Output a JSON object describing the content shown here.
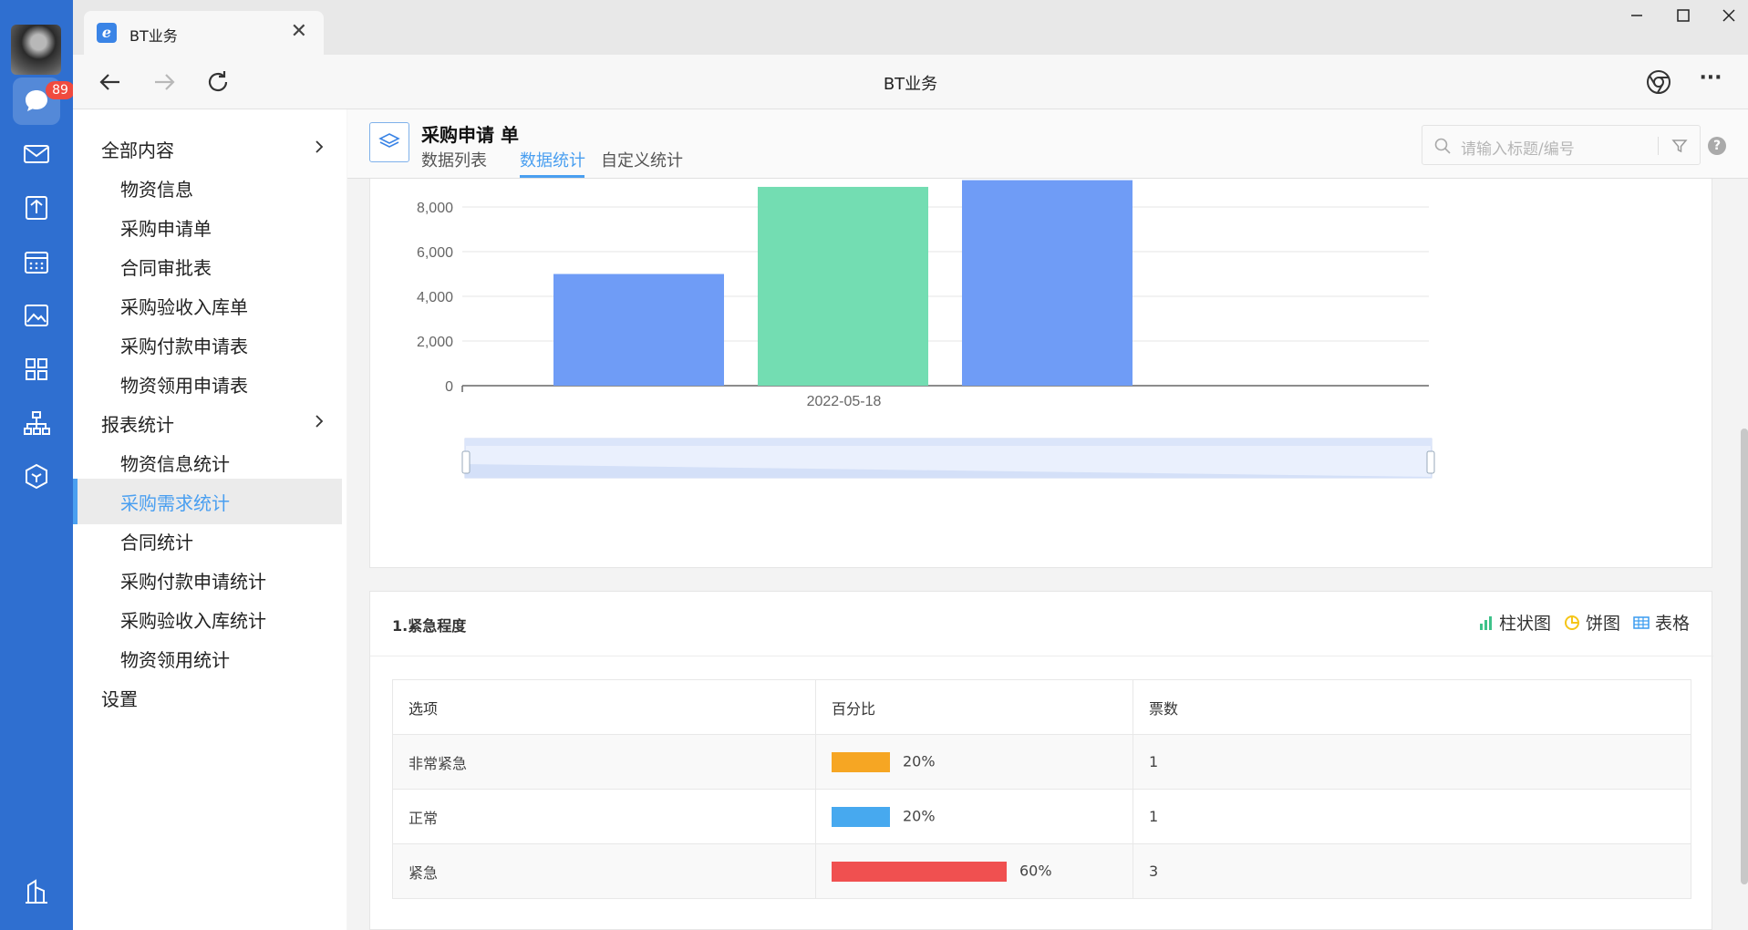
{
  "rail": {
    "badge_count": "89"
  },
  "browser": {
    "tab_title": "BT业务",
    "tab_close": "✕",
    "address_title": "BT业务",
    "more_label": "···"
  },
  "sidebar": {
    "items": [
      {
        "label": "全部内容",
        "type": "group"
      },
      {
        "label": "物资信息",
        "type": "sub"
      },
      {
        "label": "采购申请单",
        "type": "sub"
      },
      {
        "label": "合同审批表",
        "type": "sub"
      },
      {
        "label": "采购验收入库单",
        "type": "sub"
      },
      {
        "label": "采购付款申请表",
        "type": "sub"
      },
      {
        "label": "物资领用申请表",
        "type": "sub"
      },
      {
        "label": "报表统计",
        "type": "group"
      },
      {
        "label": "物资信息统计",
        "type": "sub"
      },
      {
        "label": "采购需求统计",
        "type": "sub",
        "selected": true
      },
      {
        "label": "合同统计",
        "type": "sub"
      },
      {
        "label": "采购付款申请统计",
        "type": "sub"
      },
      {
        "label": "采购验收入库统计",
        "type": "sub"
      },
      {
        "label": "物资领用统计",
        "type": "sub"
      },
      {
        "label": "设置",
        "type": "group"
      }
    ],
    "collapse_glyph": "‹"
  },
  "header": {
    "title": "采购申请 单",
    "tabs": [
      "数据列表",
      "数据统计",
      "自定义统计"
    ],
    "active_tab": 1,
    "search_placeholder": "请输入标题/编号",
    "help": "?"
  },
  "chart_data": {
    "type": "bar",
    "categories": [
      "2022-05-18"
    ],
    "series": [
      {
        "values": [
          5000
        ],
        "color": "#6f9cf6"
      },
      {
        "values": [
          8900
        ],
        "color": "#73ddb2"
      },
      {
        "values": [
          9200
        ],
        "color": "#6f9cf6"
      }
    ],
    "yticks": [
      "0",
      "2,000",
      "4,000",
      "6,000",
      "8,000"
    ],
    "ylim": [
      0,
      9200
    ],
    "grid": true
  },
  "table_section": {
    "title": "1.紧急程度",
    "views": [
      "柱状图",
      "饼图",
      "表格"
    ],
    "columns": [
      "选项",
      "百分比",
      "票数"
    ],
    "rows": [
      {
        "option": "非常紧急",
        "percent": 20,
        "percent_label": "20%",
        "votes": "1",
        "color": "#f6a623"
      },
      {
        "option": "正常",
        "percent": 20,
        "percent_label": "20%",
        "votes": "1",
        "color": "#47a9ef"
      },
      {
        "option": "紧急",
        "percent": 60,
        "percent_label": "60%",
        "votes": "3",
        "color": "#f05050"
      }
    ]
  }
}
